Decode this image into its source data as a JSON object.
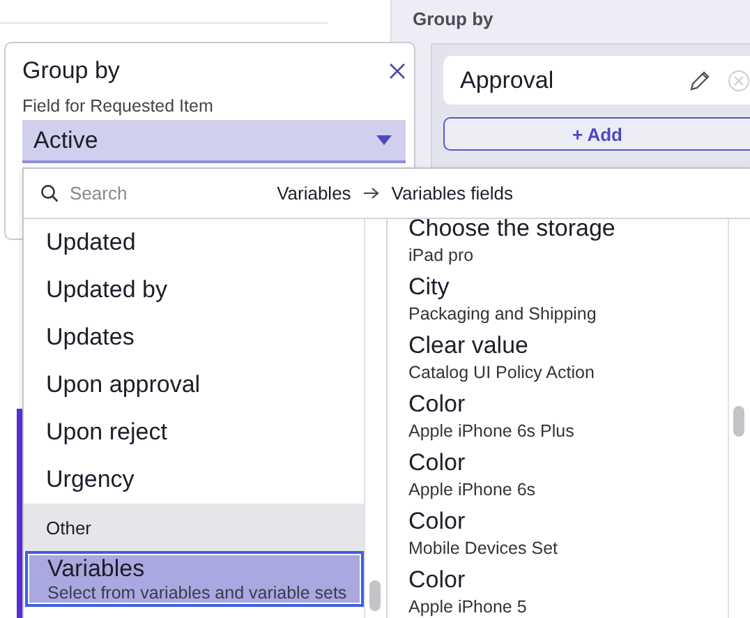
{
  "panel": {
    "title": "Group by",
    "groups": [
      {
        "label": "Approval"
      }
    ],
    "add_button": "+ Add"
  },
  "popover": {
    "title": "Group by",
    "field_label": "Field for Requested Item",
    "value": "Active"
  },
  "dropdown": {
    "search_placeholder": "Search",
    "breadcrumb": [
      "Variables",
      "Variables fields"
    ],
    "fields": [
      {
        "kind": "item",
        "label": "Updated",
        "selected": false
      },
      {
        "kind": "item",
        "label": "Updated by",
        "selected": false
      },
      {
        "kind": "item",
        "label": "Updates",
        "selected": false
      },
      {
        "kind": "item",
        "label": "Upon approval",
        "selected": false
      },
      {
        "kind": "item",
        "label": "Upon reject",
        "selected": false
      },
      {
        "kind": "item",
        "label": "Urgency",
        "selected": false
      },
      {
        "kind": "header",
        "label": "Other"
      },
      {
        "kind": "item",
        "label": "Variables",
        "description": "Select from variables and variable sets",
        "selected": true
      }
    ],
    "variables": [
      {
        "label": "Choose the storage",
        "source": "iPad pro"
      },
      {
        "label": "City",
        "source": "Packaging and Shipping"
      },
      {
        "label": "Clear value",
        "source": "Catalog UI Policy Action"
      },
      {
        "label": "Color",
        "source": "Apple iPhone 6s Plus"
      },
      {
        "label": "Color",
        "source": "Apple iPhone 6s"
      },
      {
        "label": "Color",
        "source": "Mobile Devices Set"
      },
      {
        "label": "Color",
        "source": "Apple iPhone 5"
      }
    ]
  }
}
